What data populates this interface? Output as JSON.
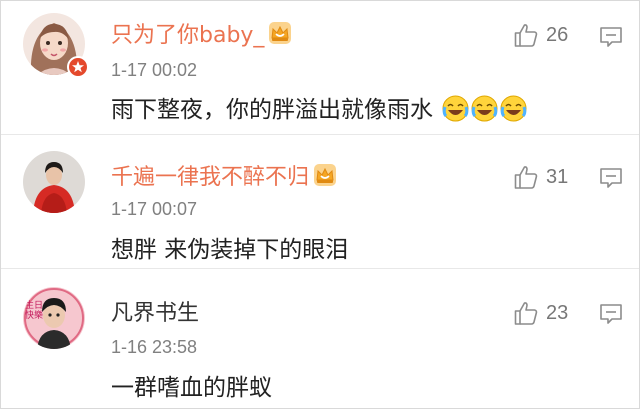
{
  "comments": [
    {
      "username": "只为了你baby_",
      "vip": true,
      "time": "1-17 00:02",
      "text": "雨下整夜，你的胖溢出就像雨水",
      "emojis": [
        "laugh-cry-icon",
        "laugh-cry-icon",
        "laugh-cry-icon"
      ],
      "likes": "26",
      "avatar_badge": true
    },
    {
      "username": "千遍一律我不醉不归",
      "vip": true,
      "time": "1-17 00:07",
      "text": "想胖 来伪装掉下的眼泪",
      "emojis": [],
      "likes": "31",
      "avatar_badge": false
    },
    {
      "username": "凡界书生",
      "vip": false,
      "time": "1-16 23:58",
      "text": "一群嗜血的胖蚁",
      "emojis": [],
      "likes": "23",
      "avatar_badge": false,
      "avatar_caption": "生日快樂"
    }
  ],
  "colors": {
    "vip_name": "#eb7350",
    "plain_name": "#333333",
    "time": "#808080",
    "icon": "#8c8c8c",
    "badge": "#e4492c",
    "crown": "#f5a623"
  }
}
